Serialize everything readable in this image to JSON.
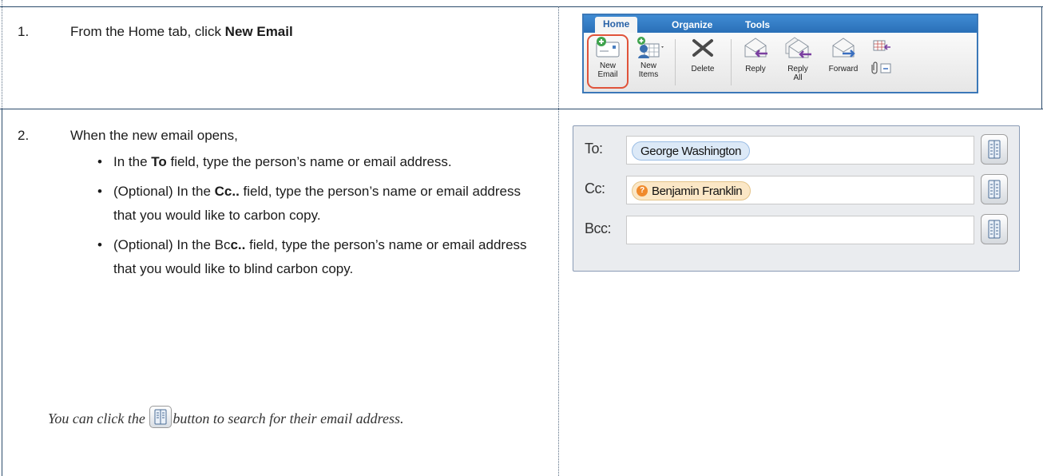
{
  "steps": [
    {
      "number": "1.",
      "text_prefix": "From the Home tab, click ",
      "text_bold": "New Email"
    },
    {
      "number": "2.",
      "intro": "When the new email opens,",
      "bullets": [
        {
          "pre": "In the ",
          "bold": "To",
          "post": " field, type the person’s name or email address."
        },
        {
          "pre": "(Optional) In the ",
          "bold": "Cc..",
          "post": " field, type the person’s name or email address that you would like to carbon copy."
        },
        {
          "pre": "(Optional) In the Bc",
          "bold": "c..",
          "post": " field, type the person’s name or email address that you would like to blind carbon copy."
        }
      ],
      "note_pre": "You can click the ",
      "note_post": "button to search for their email address."
    }
  ],
  "ribbon": {
    "tabs": [
      "Home",
      "Organize",
      "Tools"
    ],
    "active_tab": "Home",
    "buttons": [
      {
        "label": "New\nEmail",
        "icon": "new-email-icon"
      },
      {
        "label": "New\nItems",
        "icon": "new-items-icon"
      },
      {
        "label": "Delete",
        "icon": "delete-icon"
      },
      {
        "label": "Reply",
        "icon": "reply-icon"
      },
      {
        "label": "Reply\nAll",
        "icon": "reply-all-icon"
      },
      {
        "label": "Forward",
        "icon": "forward-icon"
      }
    ],
    "highlight_color": "#e0533a",
    "accent": "#2a6fb7"
  },
  "address_fields": [
    {
      "label": "To:",
      "recipient": "George Washington",
      "chip_style": "blue"
    },
    {
      "label": "Cc:",
      "recipient": "Benjamin Franklin",
      "chip_style": "orange",
      "warning": "?"
    },
    {
      "label": "Bcc:",
      "recipient": ""
    }
  ]
}
